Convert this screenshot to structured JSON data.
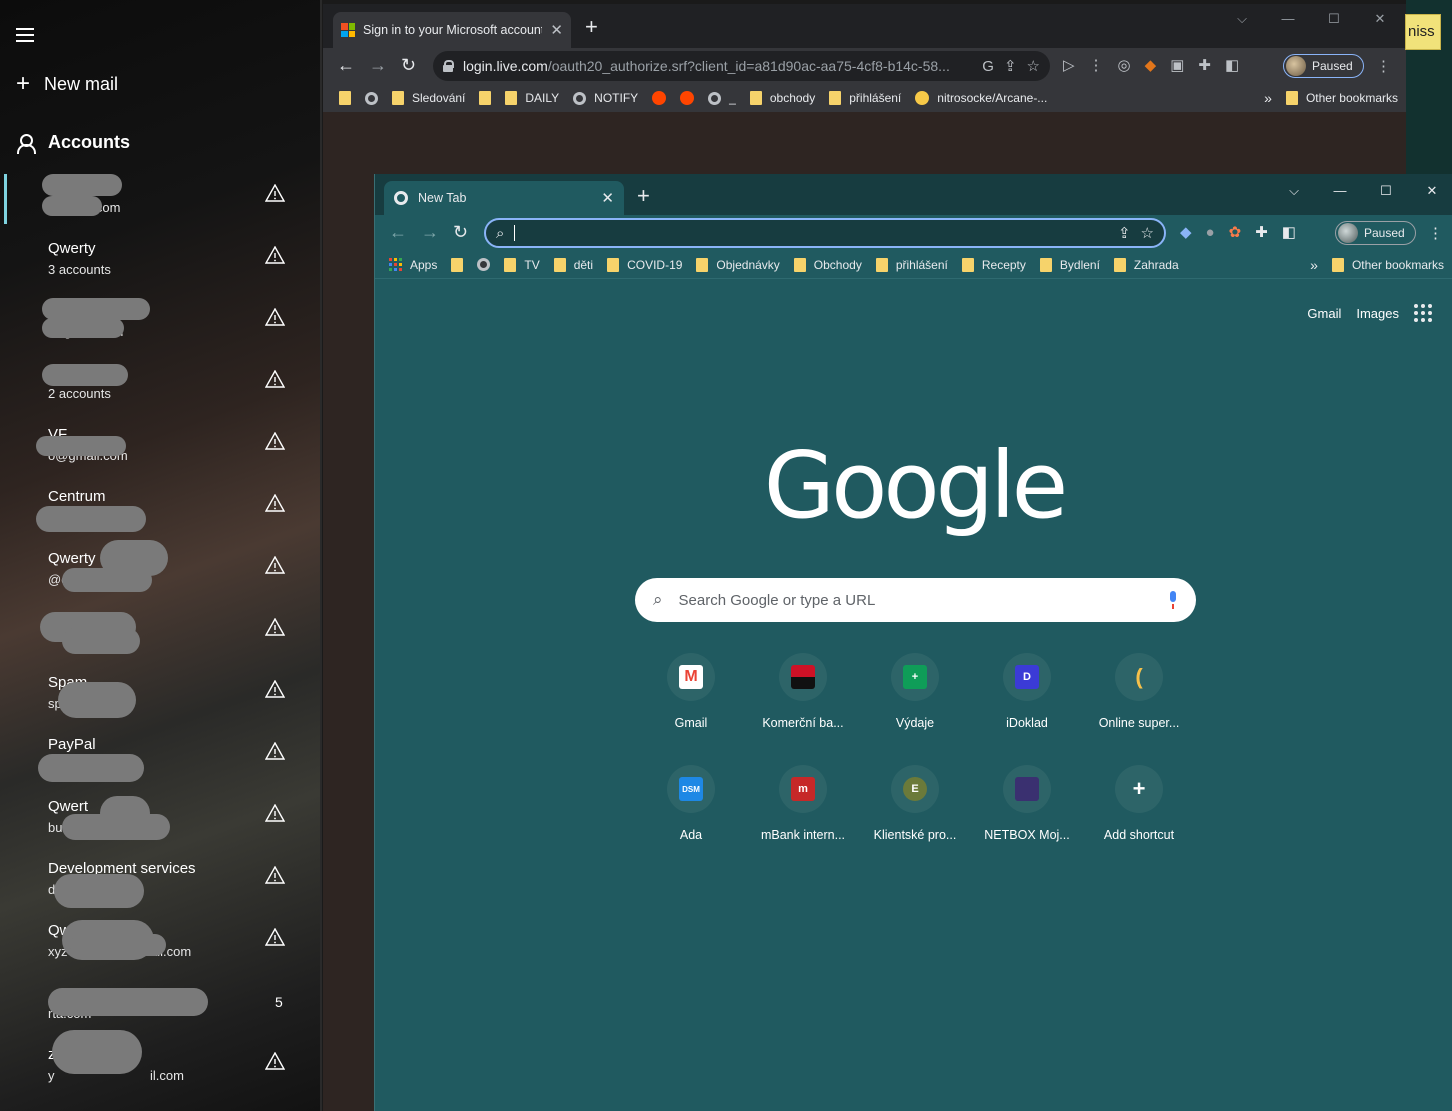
{
  "mail": {
    "new_mail": "New mail",
    "accounts_heading": "Accounts",
    "accounts": [
      {
        "name": "",
        "email": "@gmail.com",
        "warning": true,
        "count": ""
      },
      {
        "name": "Qwerty",
        "email": "3 accounts",
        "warning": true,
        "count": ""
      },
      {
        "name": "",
        "email": "i@gmail.com",
        "warning": true,
        "count": ""
      },
      {
        "name": "",
        "email": "2 accounts",
        "warning": true,
        "count": ""
      },
      {
        "name": "VF",
        "email": "o@gmail.com",
        "warning": true,
        "count": ""
      },
      {
        "name": "Centrum",
        "email": ".cz",
        "warning": true,
        "count": ""
      },
      {
        "name": "Qwerty",
        "email": "@centrum.cz",
        "warning": true,
        "count": ""
      },
      {
        "name": "to",
        "email": "",
        "warning": true,
        "count": ""
      },
      {
        "name": "Spam",
        "email": "sp",
        "warning": true,
        "count": ""
      },
      {
        "name": "PayPal",
        "email": "@gmail.com",
        "warning": true,
        "count": ""
      },
      {
        "name": "Qwert",
        "email": "busines",
        "warning": true,
        "count": ""
      },
      {
        "name": "Development services",
        "email": "d",
        "warning": true,
        "count": ""
      },
      {
        "name": "Qw",
        "email": "xyz",
        "warning": true,
        "count": ""
      },
      {
        "name": "",
        "email": "rta.com",
        "warning": false,
        "count": "5"
      },
      {
        "name": "z",
        "email": "y",
        "warning": true,
        "count": ""
      }
    ],
    "email_tail_extra": {
      "12": "ail.com",
      "14": "il.com"
    }
  },
  "window1": {
    "tab_title": "Sign in to your Microsoft account",
    "url_host": "login.live.com",
    "url_path": "/oauth20_authorize.srf?client_id=a81d90ac-aa75-4cf8-b14c-58...",
    "profile_status": "Paused",
    "bookmarks": [
      {
        "icon": "folder",
        "label": ""
      },
      {
        "icon": "globe",
        "label": ""
      },
      {
        "icon": "folder",
        "label": "Sledování"
      },
      {
        "icon": "folder",
        "label": ""
      },
      {
        "icon": "folder",
        "label": "DAILY"
      },
      {
        "icon": "globe",
        "label": "NOTIFY"
      },
      {
        "icon": "reddit",
        "label": ""
      },
      {
        "icon": "reddit",
        "label": ""
      },
      {
        "icon": "globe",
        "label": "_"
      },
      {
        "icon": "folder",
        "label": "obchody"
      },
      {
        "icon": "folder",
        "label": "přihlášení"
      },
      {
        "icon": "emoji",
        "label": "nitrosocke/Arcane-..."
      }
    ],
    "overflow": "»",
    "other_bookmarks": "Other bookmarks"
  },
  "dismiss_label": "niss",
  "window2": {
    "tab_title": "New Tab",
    "profile_status": "Paused",
    "bookmarks": [
      {
        "icon": "apps",
        "label": "Apps"
      },
      {
        "icon": "folder",
        "label": ""
      },
      {
        "icon": "globe",
        "label": ""
      },
      {
        "icon": "folder",
        "label": "TV"
      },
      {
        "icon": "folder",
        "label": "děti"
      },
      {
        "icon": "folder",
        "label": "COVID-19"
      },
      {
        "icon": "folder",
        "label": "Objednávky"
      },
      {
        "icon": "folder",
        "label": "Obchody"
      },
      {
        "icon": "folder",
        "label": "přihlášení"
      },
      {
        "icon": "folder",
        "label": "Recepty"
      },
      {
        "icon": "folder",
        "label": "Bydlení"
      },
      {
        "icon": "folder",
        "label": "Zahrada"
      }
    ],
    "overflow": "»",
    "other_bookmarks": "Other bookmarks",
    "ntp": {
      "gmail_link": "Gmail",
      "images_link": "Images",
      "logo": "Google",
      "search_placeholder": "Search Google or type a URL",
      "shortcuts": [
        {
          "label": "Gmail",
          "icon": "gmail-icon",
          "color": "#ffffff",
          "glyph": "M"
        },
        {
          "label": "Komerční ba...",
          "icon": "kb-icon",
          "color": "#ce1126",
          "glyph": ""
        },
        {
          "label": "Výdaje",
          "icon": "sheets-icon",
          "color": "#0f9d58",
          "glyph": "+"
        },
        {
          "label": "iDoklad",
          "icon": "idoklad-icon",
          "color": "#3b3bd6",
          "glyph": "D"
        },
        {
          "label": "Online super...",
          "icon": "banana-icon",
          "color": "#2d6468",
          "glyph": "("
        },
        {
          "label": "Ada",
          "icon": "dsm-icon",
          "color": "#1e88e5",
          "glyph": "DSM"
        },
        {
          "label": "mBank intern...",
          "icon": "mbank-icon",
          "color": "#c62828",
          "glyph": "m"
        },
        {
          "label": "Klientské pro...",
          "icon": "e-icon",
          "color": "#6b7a3a",
          "glyph": "E"
        },
        {
          "label": "NETBOX Moj...",
          "icon": "netbox-icon",
          "color": "#3a3070",
          "glyph": ""
        },
        {
          "label": "Add shortcut",
          "icon": "plus-icon",
          "color": "#2d6468",
          "glyph": "+"
        }
      ]
    }
  }
}
